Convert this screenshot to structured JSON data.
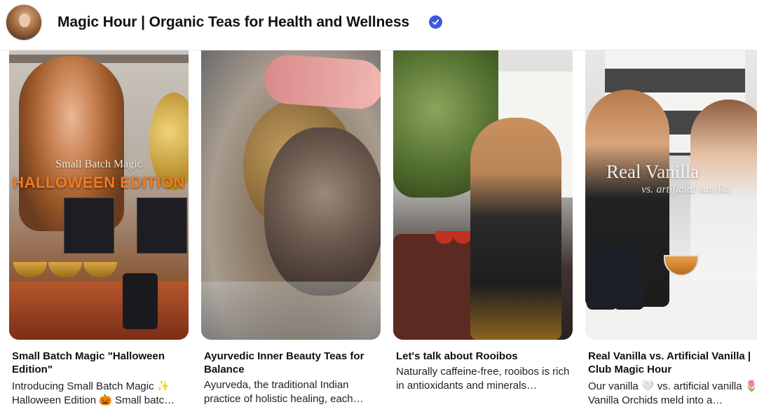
{
  "board": {
    "title": "Magic Hour | Organic Teas for Health and Wellness",
    "verified_icon": "verified-badge-icon",
    "accent_color": "#3b5bdb"
  },
  "pins": [
    {
      "title": "Small Batch Magic \"Halloween Edition\"",
      "description": "Introducing Small Batch Magic ✨ Halloween Edition 🎃 Small batc…",
      "overlay_line1": "Small Batch Magic",
      "overlay_line2": "HALLOWEEN EDITION"
    },
    {
      "title": "Ayurvedic Inner Beauty Teas for Balance",
      "description": "Ayurveda, the traditional Indian practice of holistic healing, each…"
    },
    {
      "title": "Let's talk about Rooibos",
      "description": "Naturally caffeine-free, rooibos is rich in antioxidants and minerals…"
    },
    {
      "title": "Real Vanilla vs. Artificial Vanilla | Club Magic Hour",
      "description": "Our vanilla 🤍 vs. artificial vanilla 🌷 Vanilla Orchids meld into a…",
      "overlay_line1": "Real Vanilla",
      "overlay_line2": "vs. artificial vanilla"
    }
  ]
}
